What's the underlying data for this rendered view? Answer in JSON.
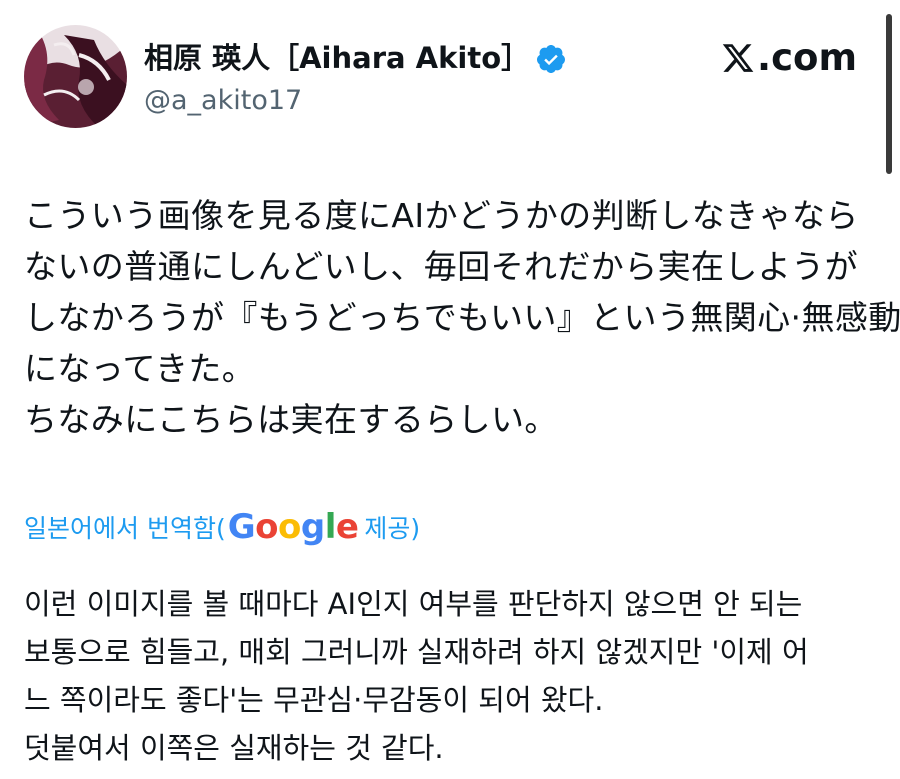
{
  "author": {
    "display_name": "相原 瑛人［Aihara Akito］",
    "handle": "@a_akito17",
    "verified_icon": "verified-badge-icon",
    "avatar_icon": "avatar-image"
  },
  "brand": {
    "logo_text": ".com",
    "logo_icon": "x-logo-icon"
  },
  "tweet": {
    "lines": [
      "こういう画像を見る度にAIかどうかの判断しなきゃなら",
      "ないの普通にしんどいし、毎回それだから実在しようが",
      "しなかろうが『もうどっちでもいい』という無関心·無感動",
      "になってきた。",
      "ちなみにこちらは実在するらしい。"
    ]
  },
  "translate": {
    "prefix": "일본어에서 번역함(",
    "google": [
      "G",
      "o",
      "o",
      "g",
      "l",
      "e"
    ],
    "suffix": " 제공)"
  },
  "translation": {
    "lines": [
      "이런 이미지를 볼 때마다 AI인지 여부를 판단하지 않으면 안 되는",
      "보통으로 힘들고, 매회 그러니까 실재하려 하지 않겠지만 '이제 어",
      "느 쪽이라도 좋다'는 무관심·무감동이 되어 왔다.",
      "덧붙여서 이쪽은 실재하는 것 같다."
    ]
  },
  "colors": {
    "link": "#1d9bf0",
    "verified": "#1d9bf0",
    "handle": "#536471",
    "text": "#0f1419"
  }
}
